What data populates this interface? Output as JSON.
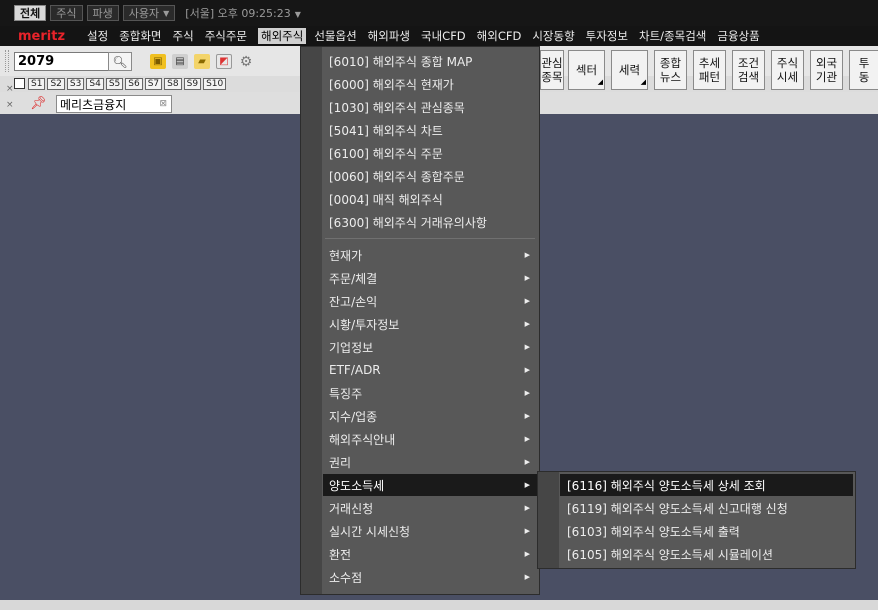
{
  "topbar": {
    "tabs": [
      "전체",
      "주식",
      "파생",
      "사용자"
    ],
    "clock": "[서울] 오후 09:25:23"
  },
  "menubar": {
    "logo": "meritz",
    "items": [
      "설정",
      "종합화면",
      "주식",
      "주식주문",
      "해외주식",
      "선물옵션",
      "해외파생",
      "국내CFD",
      "해외CFD",
      "시장동향",
      "투자정보",
      "차트/종목검색",
      "금융상품"
    ]
  },
  "toolbar": {
    "code_value": "2079",
    "slots": [
      "S1",
      "S2",
      "S3",
      "S4",
      "S5",
      "S6",
      "S7",
      "S8",
      "S9",
      "S10"
    ],
    "right_buttons": [
      {
        "l1": "관심",
        "l2": "종목"
      },
      {
        "l1": "섹터",
        "l2": ""
      },
      {
        "l1": "세력",
        "l2": ""
      },
      {
        "l1": "종합",
        "l2": "뉴스"
      },
      {
        "l1": "추세",
        "l2": "패턴"
      },
      {
        "l1": "조건",
        "l2": "검색"
      },
      {
        "l1": "주식",
        "l2": "시세"
      },
      {
        "l1": "외국",
        "l2": "기관"
      },
      {
        "l1": "투",
        "l2": "동"
      }
    ]
  },
  "tab": {
    "label": "메리츠금융지"
  },
  "menu": {
    "direct_items": [
      "[6010] 해외주식 종합 MAP",
      "[6000] 해외주식 현재가",
      "[1030] 해외주식 관심종목",
      "[5041] 해외주식 차트",
      "[6100] 해외주식 주문",
      "[0060] 해외주식 종합주문",
      "[0004] 매직 해외주식",
      "[6300] 해외주식 거래유의사항"
    ],
    "sub_items": [
      "현재가",
      "주문/체결",
      "잔고/손익",
      "시황/투자정보",
      "기업정보",
      "ETF/ADR",
      "특징주",
      "지수/업종",
      "해외주식안내",
      "권리",
      "양도소득세",
      "거래신청",
      "실시간 시세신청",
      "환전",
      "소수점"
    ]
  },
  "submenu": {
    "items": [
      "[6116] 해외주식 양도소득세 상세 조회",
      "[6119] 해외주식 양도소득세 신고대행 신청",
      "[6103] 해외주식 양도소득세 출력",
      "[6105] 해외주식 양도소득세 시뮬레이션"
    ]
  },
  "colors": {
    "selected": "#1a1a1a",
    "menu_bg": "#585858",
    "logo": "#e8232a",
    "desktop": "#4a4f64"
  }
}
